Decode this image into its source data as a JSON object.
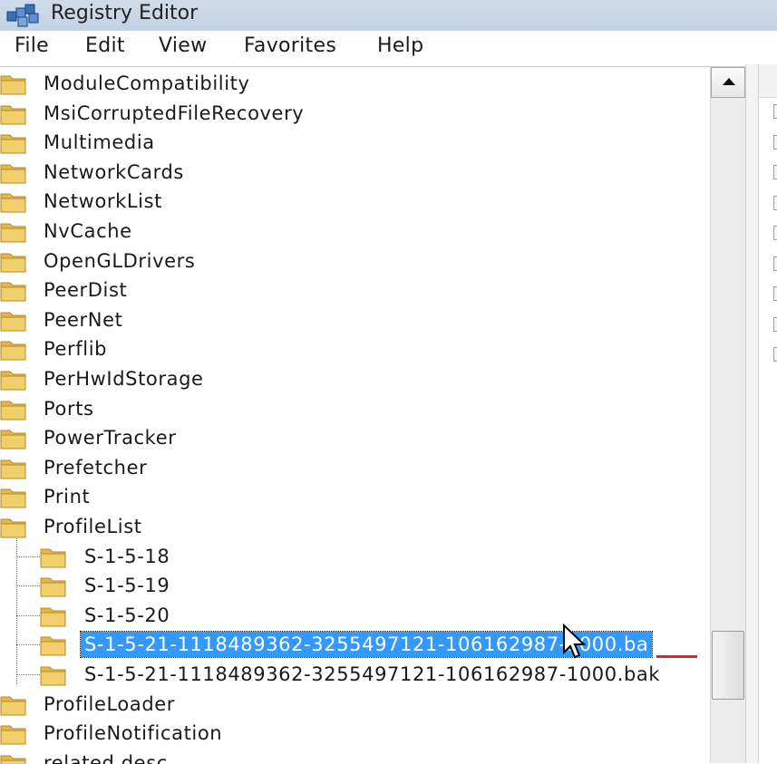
{
  "window": {
    "title": "Registry Editor"
  },
  "menu": [
    "File",
    "Edit",
    "View",
    "Favorites",
    "Help"
  ],
  "tree": {
    "top_items": [
      "ModuleCompatibility",
      "MsiCorruptedFileRecovery",
      "Multimedia",
      "NetworkCards",
      "NetworkList",
      "NvCache",
      "OpenGLDrivers",
      "PeerDist",
      "PeerNet",
      "Perflib",
      "PerHwIdStorage",
      "Ports",
      "PowerTracker",
      "Prefetcher",
      "Print",
      "ProfileList"
    ],
    "profile_children": [
      "S-1-5-18",
      "S-1-5-19",
      "S-1-5-20",
      "S-1-5-21-1118489362-3255497121-106162987-1000.ba",
      "S-1-5-21-1118489362-3255497121-106162987-1000.bak"
    ],
    "bottom_items": [
      "ProfileLoader",
      "ProfileNotification",
      "related.desc"
    ],
    "selected": "S-1-5-21-1118489362-3255497121-106162987-1000.ba"
  },
  "colors": {
    "selection": "#3399ff",
    "folder": "#e8c15a",
    "underline": "#e0231b"
  },
  "icons": {
    "app": "registry-icon",
    "folder": "folder-icon",
    "scroll_up": "scroll-up-arrow-icon",
    "cursor": "mouse-pointer-icon"
  }
}
